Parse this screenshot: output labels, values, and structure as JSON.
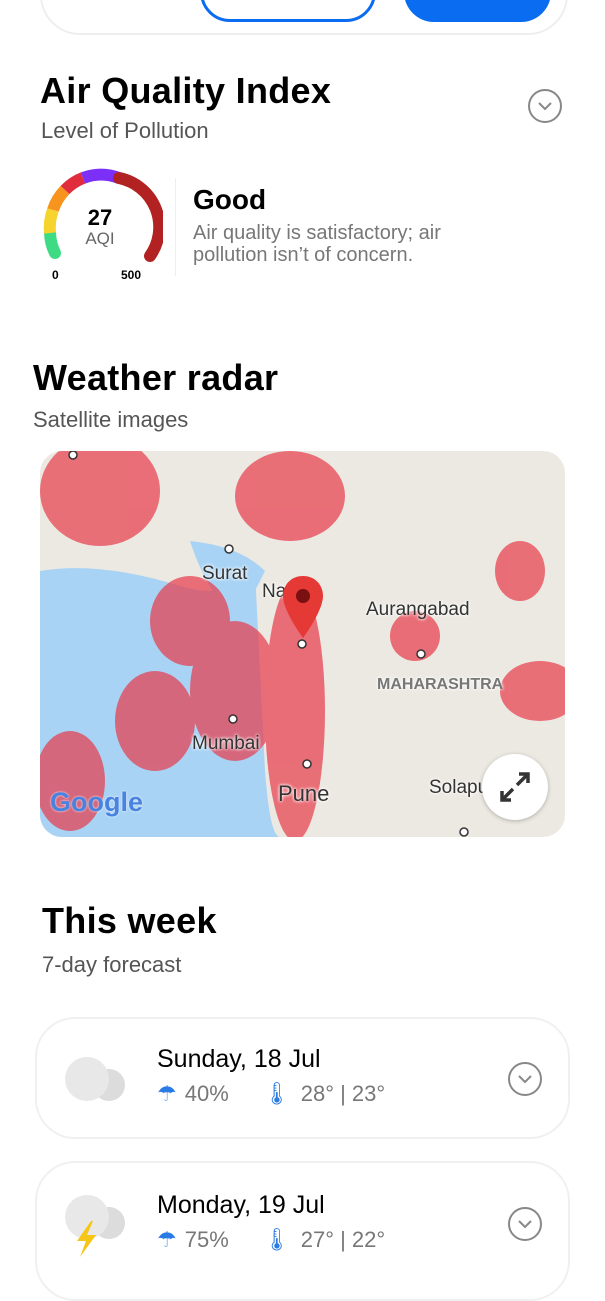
{
  "aqi": {
    "title": "Air Quality Index",
    "subtitle": "Level of Pollution",
    "value": "27",
    "unit": "AQI",
    "min": "0",
    "max": "500",
    "level": "Good",
    "description": "Air quality is satisfactory; air pollution isn’t of concern.",
    "gauge_fraction": 0.054
  },
  "radar": {
    "title": "Weather radar",
    "subtitle": "Satellite images",
    "cities": {
      "surat": "Surat",
      "nashik": "Nashik",
      "aurangabad": "Aurangabad",
      "maharashtra": "MAHARASHTRA",
      "mumbai": "Mumbai",
      "pune": "Pune",
      "solapur": "Solapur"
    },
    "logo": "Google"
  },
  "week": {
    "title": "This week",
    "subtitle": "7-day forecast",
    "days": [
      {
        "date": "Sunday, 18 Jul",
        "rain": "40%",
        "temp": "28° | 23°",
        "icon": "cloudy-icon"
      },
      {
        "date": "Monday, 19 Jul",
        "rain": "75%",
        "temp": "27° | 22°",
        "icon": "thunderstorm-icon"
      }
    ]
  },
  "colors": {
    "accent": "#0a6cf0",
    "good": "#3ddc84"
  }
}
